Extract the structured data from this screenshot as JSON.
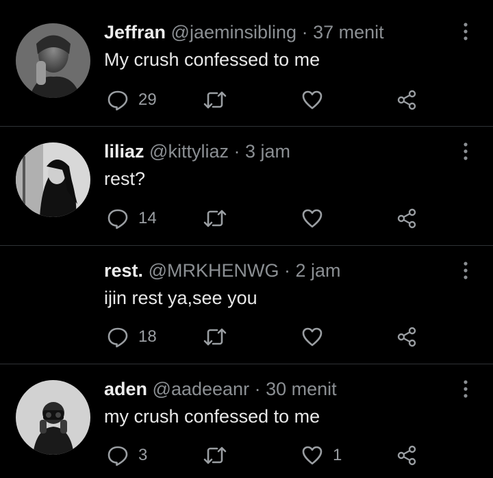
{
  "tweets": [
    {
      "name": "Jeffran",
      "handle": "@jaeminsibling",
      "dot": "·",
      "time": "37 menit",
      "text": "My crush confessed to me",
      "replies": "29",
      "retweets": "",
      "likes": "",
      "avatar": "photo-avatar"
    },
    {
      "name": "liliaz",
      "handle": "@kittyliaz",
      "dot": "·",
      "time": "3 jam",
      "text": "rest?",
      "replies": "14",
      "retweets": "",
      "likes": "",
      "avatar": "photo-avatar"
    },
    {
      "name": "rest.",
      "handle": "@MRKHENWG",
      "dot": "·",
      "time": "2 jam",
      "text": "ijin rest ya,see you",
      "replies": "18",
      "retweets": "",
      "likes": "",
      "avatar": "none"
    },
    {
      "name": "aden",
      "handle": "@aadeeanr",
      "dot": "·",
      "time": "30 menit",
      "text": "my crush confessed to me",
      "replies": "3",
      "retweets": "",
      "likes": "1",
      "avatar": "photo-avatar"
    }
  ],
  "colors": {
    "background": "#000000",
    "text": "#e8e8e8",
    "muted": "#8b8f93",
    "icon": "#9a9ea2",
    "divider": "#2f3336"
  },
  "icons": [
    "reply-icon",
    "retweet-icon",
    "like-icon",
    "share-icon",
    "more-options-icon"
  ]
}
